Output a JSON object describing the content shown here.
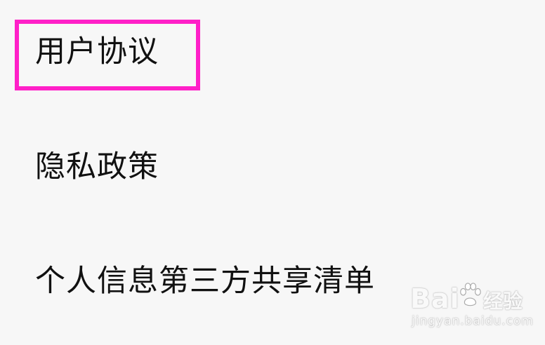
{
  "menu": {
    "items": [
      {
        "label": "用户协议",
        "highlighted": true
      },
      {
        "label": "隐私政策",
        "highlighted": false
      },
      {
        "label": "个人信息第三方共享清单",
        "highlighted": false
      }
    ]
  },
  "colors": {
    "background": "#f7f7f7",
    "text": "#111111",
    "highlight": "#ff20c8"
  },
  "watermark": {
    "brand": "Bai",
    "brand_suffix": "经验",
    "url": "jingyan.baidu.com",
    "paw_icon": "baidu-paw-icon"
  }
}
